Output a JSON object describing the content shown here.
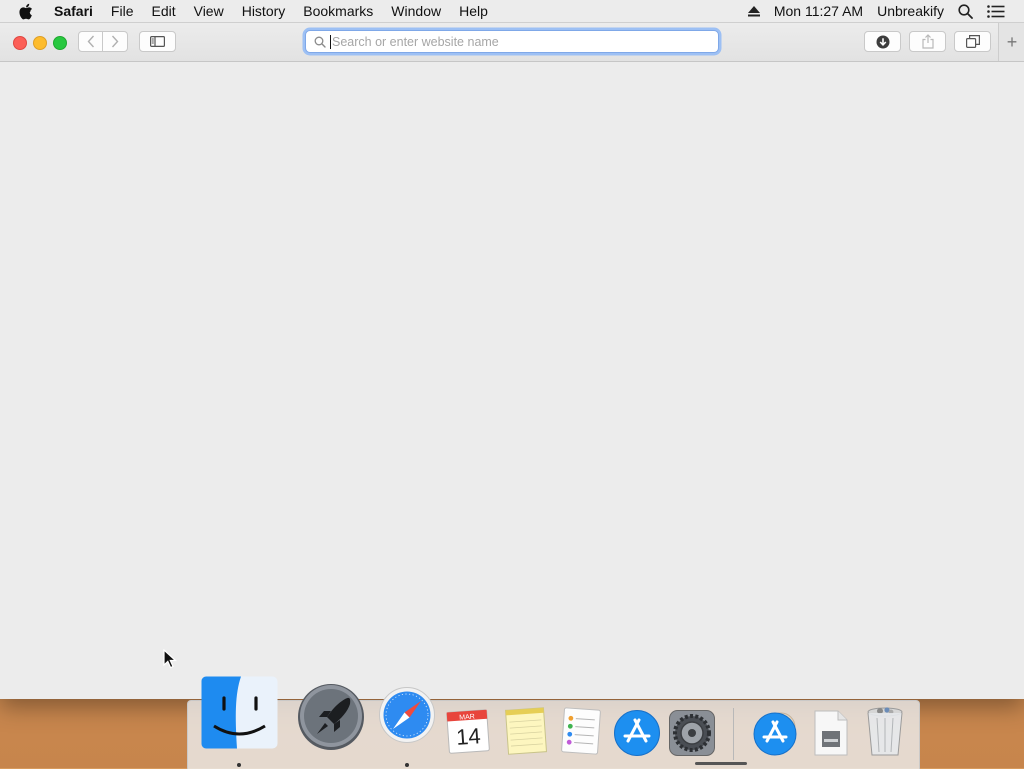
{
  "menubar": {
    "app_name": "Safari",
    "menus": [
      "File",
      "Edit",
      "View",
      "History",
      "Bookmarks",
      "Window",
      "Help"
    ],
    "clock": "Mon 11:27 AM",
    "user": "Unbreakify",
    "icons": [
      "apple-icon",
      "eject-icon",
      "spotlight-icon",
      "notification-center-icon"
    ]
  },
  "toolbar": {
    "address_placeholder": "Search or enter website name",
    "address_value": "",
    "new_tab": "+"
  },
  "dock": {
    "apps": [
      "Finder",
      "Launchpad",
      "Safari",
      "Calendar",
      "Notes",
      "Reminders",
      "App Store",
      "System Preferences",
      "App Store Downloads",
      "Document",
      "Trash"
    ],
    "calendar": {
      "month": "MAR",
      "day": "14"
    },
    "running": [
      "Finder",
      "Safari"
    ]
  },
  "colors": {
    "close": "#fc5f57",
    "minimize": "#fdbc2e",
    "zoom": "#28c840",
    "focus_ring": "#9dc0f4"
  }
}
